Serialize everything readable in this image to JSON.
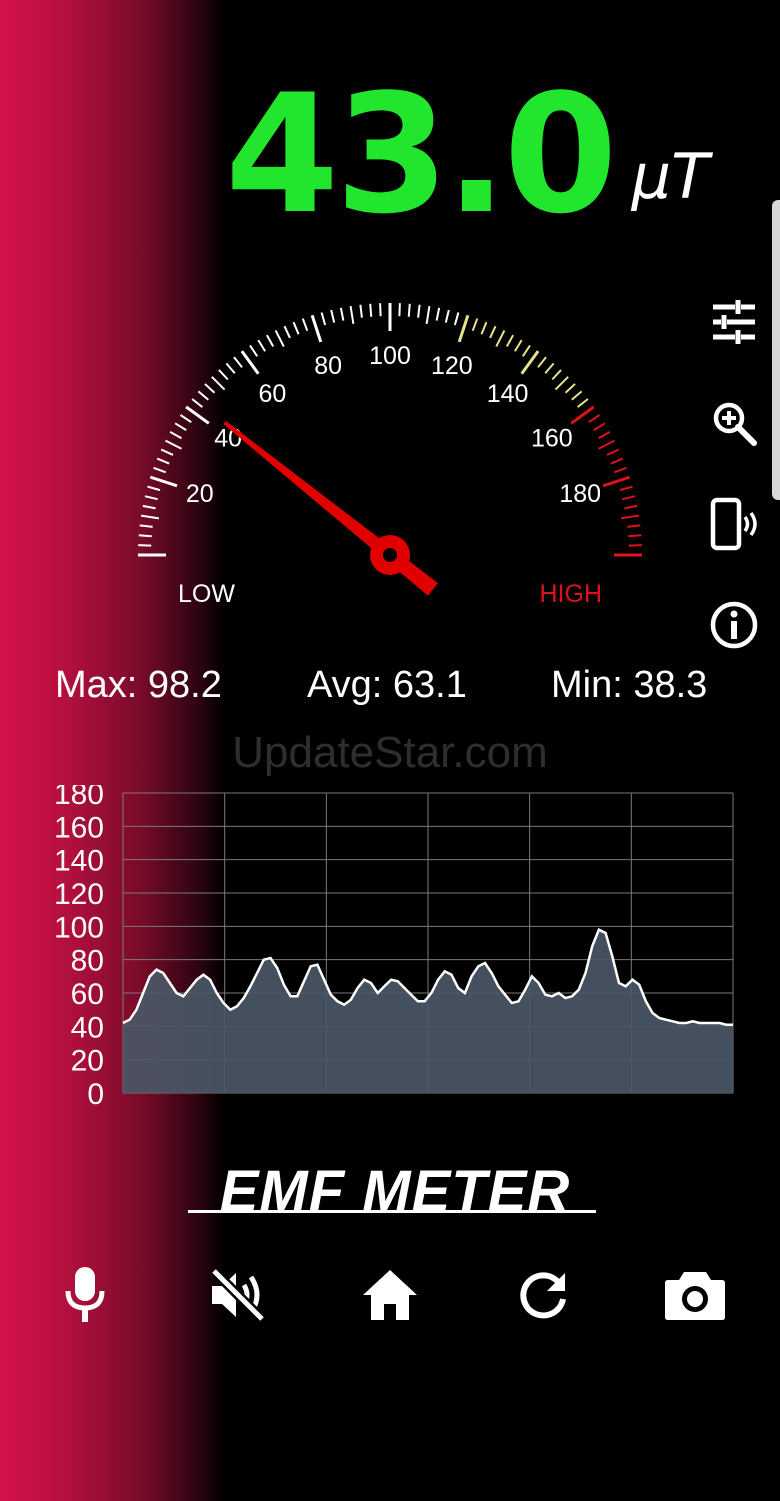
{
  "reading": {
    "value": "43.0",
    "unit": "µT"
  },
  "gauge": {
    "min": 0,
    "max": 200,
    "needle_value": 43.0,
    "major_labels": [
      "20",
      "40",
      "60",
      "80",
      "100",
      "120",
      "140",
      "160",
      "180"
    ],
    "low_label": "LOW",
    "high_label": "HIGH",
    "colors": {
      "normal": "#ffffff",
      "caution": "#e8e28a",
      "danger": "#e0101c",
      "needle": "#e00000"
    }
  },
  "stats": {
    "max": "Max: 98.2",
    "avg": "Avg: 63.1",
    "min": "Min: 38.3"
  },
  "watermark": "UpdateStar.com",
  "side_icons": [
    "tune-sliders-icon",
    "zoom-in-icon",
    "vibrate-phone-icon",
    "info-icon"
  ],
  "chart_data": {
    "type": "area",
    "ylim": [
      0,
      180
    ],
    "y_ticks": [
      "180",
      "160",
      "140",
      "120",
      "100",
      "80",
      "60",
      "40",
      "20",
      "0"
    ],
    "grid": true,
    "values": [
      42,
      44,
      50,
      60,
      70,
      74,
      72,
      66,
      60,
      58,
      63,
      68,
      71,
      68,
      60,
      54,
      50,
      52,
      57,
      64,
      72,
      80,
      81,
      75,
      65,
      58,
      58,
      67,
      76,
      77,
      68,
      59,
      55,
      53,
      56,
      63,
      68,
      66,
      60,
      64,
      68,
      67,
      63,
      59,
      55,
      55,
      60,
      68,
      73,
      71,
      63,
      60,
      70,
      76,
      78,
      72,
      64,
      59,
      54,
      55,
      62,
      70,
      66,
      59,
      58,
      60,
      57,
      58,
      62,
      72,
      88,
      98,
      96,
      82,
      66,
      64,
      68,
      65,
      55,
      48,
      45,
      44,
      43,
      42,
      42,
      43,
      42,
      42,
      42,
      42,
      41,
      41
    ],
    "fill_color": "#4a5766",
    "line_color": "#ffffff"
  },
  "brand": "EMF METER",
  "bottom_bar": [
    "microphone-icon",
    "mute-icon",
    "home-icon",
    "refresh-icon",
    "camera-icon"
  ]
}
